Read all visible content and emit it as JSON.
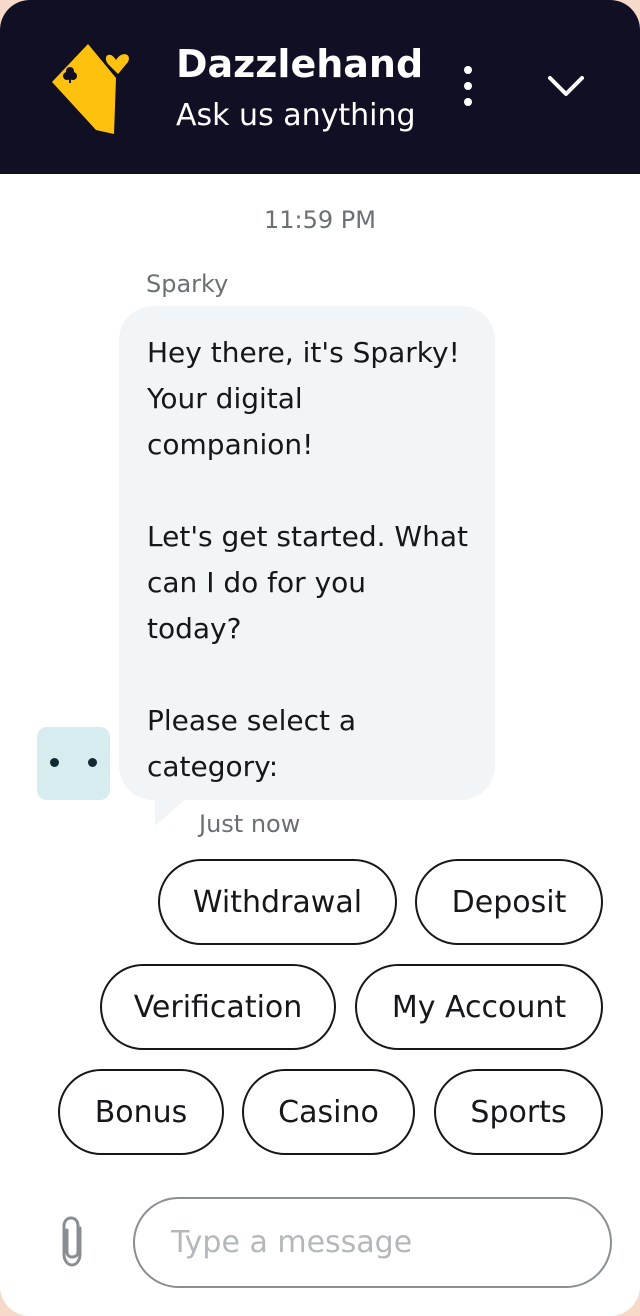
{
  "header": {
    "brand": "Dazzlehand",
    "tagline": "Ask us anything",
    "logo_icon": "playing-card-logo-icon",
    "accent_color": "#fec20e",
    "background_color": "#100f23"
  },
  "conversation": {
    "timestamp": "11:59 PM",
    "sender": "Sparky",
    "message": "Hey there, it's Sparky!\nYour digital\ncompanion!\n\nLet's get started. What\ncan I do for you\ntoday?\n\nPlease select a\ncategory:",
    "message_time": "Just now"
  },
  "categories": [
    "Withdrawal",
    "Deposit",
    "Verification",
    "My Account",
    "Bonus",
    "Casino",
    "Sports"
  ],
  "composer": {
    "placeholder": "Type a message"
  }
}
